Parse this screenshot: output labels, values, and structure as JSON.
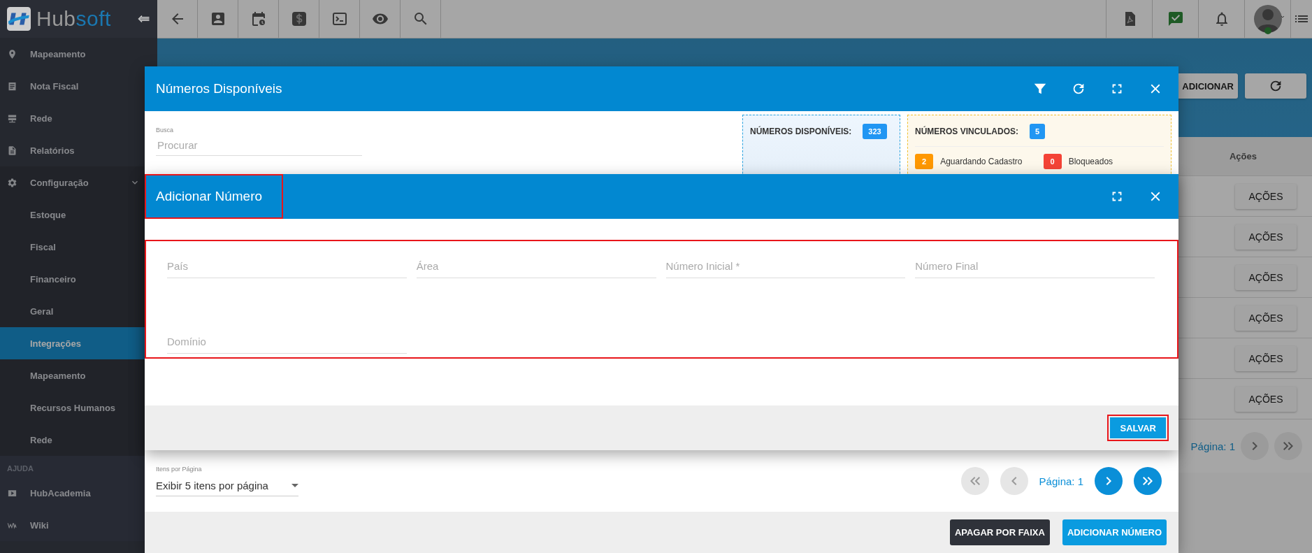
{
  "logo": {
    "parts": [
      {
        "text": "Hub",
        "color": "#9a9a9a"
      },
      {
        "text": "soft",
        "color": "#1a77b0"
      }
    ]
  },
  "sidebar": {
    "items": [
      {
        "label": "Mapeamento",
        "selected": false
      },
      {
        "label": "Nota Fiscal",
        "selected": false
      },
      {
        "label": "Rede",
        "selected": false
      },
      {
        "label": "Relatórios",
        "selected": false
      },
      {
        "label": "Configuração",
        "selected": false,
        "expanded": true,
        "children": [
          {
            "label": "Estoque",
            "selected": false
          },
          {
            "label": "Fiscal",
            "selected": false
          },
          {
            "label": "Financeiro",
            "selected": false
          },
          {
            "label": "Geral",
            "selected": false
          },
          {
            "label": "Integrações",
            "selected": true
          },
          {
            "label": "Mapeamento",
            "selected": false
          },
          {
            "label": "Recursos Humanos",
            "selected": false
          },
          {
            "label": "Rede",
            "selected": false
          }
        ]
      }
    ],
    "help": {
      "heading": "AJUDA",
      "items": [
        {
          "label": "HubAcademia",
          "selected": false
        },
        {
          "label": "Wiki",
          "selected": false
        }
      ]
    }
  },
  "page": {
    "add_button": "ADICIONAR",
    "table": {
      "columns": [
        "Ações"
      ],
      "rows": [
        {
          "action": "AÇÕES"
        },
        {
          "action": "AÇÕES"
        },
        {
          "action": "AÇÕES"
        },
        {
          "action": "AÇÕES"
        },
        {
          "action": "AÇÕES"
        },
        {
          "action": "AÇÕES"
        }
      ]
    },
    "pagination": {
      "page": "Página: 1"
    }
  },
  "dialog": {
    "title": "Números Disponíveis",
    "search": {
      "label": "Busca",
      "placeholder": "Procurar"
    },
    "available": {
      "label": "NÚMEROS DISPONÍVEIS:",
      "count": "323",
      "color": "#2196f3"
    },
    "linked": {
      "label": "NÚMEROS VINCULADOS:",
      "count": "5",
      "color": "#2196f3",
      "statuses": [
        {
          "count": "2",
          "label": "Aguardando Cadastro",
          "color": "#ff9800"
        },
        {
          "count": "0",
          "label": "Bloqueados",
          "color": "#f44336"
        }
      ]
    },
    "page_size": {
      "label": "Itens por Página",
      "value": "Exibir 5 itens por página"
    },
    "pagination": {
      "page": "Página: 1",
      "buttons": [
        {
          "kind": "first",
          "disabled": true
        },
        {
          "kind": "prev",
          "disabled": true
        },
        {
          "kind": "next",
          "disabled": false
        },
        {
          "kind": "last",
          "disabled": false
        }
      ]
    },
    "buttons": [
      {
        "label": "APAGAR POR FAIXA",
        "kind": "dark"
      },
      {
        "label": "ADICIONAR NÚMERO",
        "kind": "primary"
      }
    ]
  },
  "add_dialog": {
    "title": "Adicionar Número",
    "fields": [
      {
        "placeholder": "País"
      },
      {
        "placeholder": "Área"
      },
      {
        "placeholder": "Número Inicial *"
      },
      {
        "placeholder": "Número Final"
      },
      {
        "placeholder": "Domínio"
      }
    ],
    "save_button": "SALVAR"
  }
}
